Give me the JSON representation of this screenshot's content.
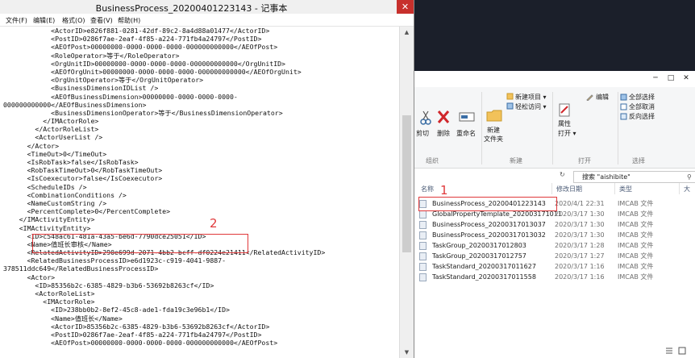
{
  "notepad": {
    "title": "BusinessProcess_20200401223143 - 记事本",
    "close_glyph": "✕",
    "menu": [
      "文件(F)",
      "编辑(E)",
      "格式(O)",
      "查看(V)",
      "帮助(H)"
    ],
    "lines": [
      "            <ActorID>e826f881-0281-42df-89c2-8a4d88a01477</ActorID>",
      "            <PostID>0286f7ae-2eaf-4f85-a224-771fb4a24797</PostID>",
      "            <AEOfPost>00000000-0000-0000-0000-000000000000</AEOfPost>",
      "            <RoleOperator>等于</RoleOperator>",
      "            <OrgUnitID>00000000-0000-0000-0000-000000000000</OrgUnitID>",
      "            <AEOfOrgUnit>00000000-0000-0000-0000-000000000000</AEOfOrgUnit>",
      "            <OrgUnitOperator>等于</OrgUnitOperator>",
      "            <BusinessDimensionIDList />",
      "            <AEOfBusinessDimension>00000000-0000-0000-0000-",
      "000000000000</AEOfBusinessDimension>",
      "            <BusinessDimensionOperator>等于</BusinessDimensionOperator>",
      "          </IMActorRole>",
      "        </ActorRoleList>",
      "        <ActorUserList />",
      "      </Actor>",
      "      <TimeOut>0</TimeOut>",
      "      <IsRobTask>false</IsRobTask>",
      "      <RobTaskTimeOut>0</RobTaskTimeOut>",
      "      <IsCoexecutor>false</IsCoexecutor>",
      "      <ScheduleIDs />",
      "      <CombinationConditions />",
      "      <NameCustomString />",
      "      <PercentComplete>0</PercentComplete>",
      "    </IMActivityEntity>",
      "    <IMActivityEntity>",
      "      <ID>c548ac61-481a-43a5-be6d-7790dce25051</ID>",
      "      <Name>值班长审核</Name>",
      "      <RelatedActivityID>290e699d-2071-4bb2-bcff-df0224e21411</RelatedActivityID>",
      "      <RelatedBusinessProcessID>e6d1923c-c919-4041-9887-",
      "378511ddc649</RelatedBusinessProcessID>",
      "      <Actor>",
      "        <ID>85356b2c-6385-4829-b3b6-53692b8263cf</ID>",
      "        <ActorRoleList>",
      "          <IMActorRole>",
      "            <ID>238bb0b2-8ef2-45c8-ade1-fda19c3e96b1</ID>",
      "            <Name>值班长</Name>",
      "            <ActorID>85356b2c-6385-4829-b3b6-53692b8263cf</ActorID>",
      "            <PostID>0286f7ae-2eaf-4f85-a224-771fb4a24797</PostID>",
      "            <AEOfPost>00000000-0000-0000-0000-000000000000</AEOfPost>"
    ],
    "annotation_2": "2"
  },
  "explorer": {
    "window_buttons": [
      "─",
      "□",
      "✕"
    ],
    "ribbon": {
      "cut": "剪切",
      "delete": "删除",
      "rename": "重命名",
      "new_folder": "新建\n文件夹",
      "new_item": "新建项目 ▾",
      "easy_access": "轻松访问 ▾",
      "properties": "属性",
      "open": "打开 ▾",
      "edit": "编辑",
      "select_all": "全部选择",
      "select_none": "全部取消",
      "invert_selection": "反向选择",
      "group_organize": "组织",
      "group_new": "新建",
      "group_open": "打开",
      "group_select": "选择"
    },
    "search_placeholder": "搜索 \"aishibite\"",
    "columns": [
      "名称",
      "修改日期",
      "类型",
      "大"
    ],
    "files": [
      {
        "name": "BusinessProcess_20200401223143",
        "date": "2020/4/1 22:31",
        "type": "IMCAB 文件"
      },
      {
        "name": "GlobalPropertyTemplate_202003171011",
        "date": "2020/3/17 1:30",
        "type": "IMCAB 文件"
      },
      {
        "name": "BusinessProcess_20200317013037",
        "date": "2020/3/17 1:30",
        "type": "IMCAB 文件"
      },
      {
        "name": "BusinessProcess_20200317013032",
        "date": "2020/3/17 1:30",
        "type": "IMCAB 文件"
      },
      {
        "name": "TaskGroup_20200317012803",
        "date": "2020/3/17 1:28",
        "type": "IMCAB 文件"
      },
      {
        "name": "TaskGroup_20200317012757",
        "date": "2020/3/17 1:27",
        "type": "IMCAB 文件"
      },
      {
        "name": "TaskStandard_20200317011627",
        "date": "2020/3/17 1:16",
        "type": "IMCAB 文件"
      },
      {
        "name": "TaskStandard_20200317011558",
        "date": "2020/3/17 1:16",
        "type": "IMCAB 文件"
      }
    ],
    "annotation_1": "1"
  }
}
